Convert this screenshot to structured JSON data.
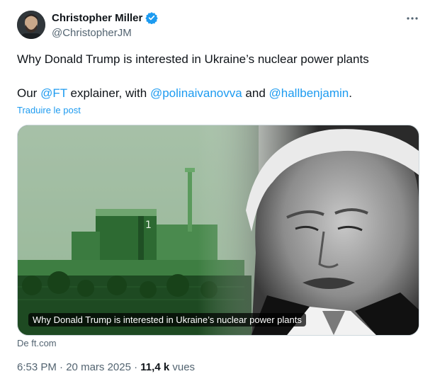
{
  "author": {
    "name": "Christopher Miller",
    "handle": "@ChristopherJM",
    "verified_icon": "verified-badge-icon"
  },
  "more_icon": "more-horizontal-icon",
  "tweet": {
    "line1": "Why Donald Trump is interested in Ukraine’s nuclear power plants",
    "line2_prefix": "Our ",
    "mention_ft": "@FT",
    "line2_mid": " explainer, with ",
    "mention_polina": "@polinaivanovva",
    "line2_and": " and ",
    "mention_hall": "@hallbenjamin",
    "line2_end": "."
  },
  "translate_label": "Traduire le post",
  "card": {
    "title": "Why Donald Trump is interested in Ukraine’s nuclear power plants",
    "source": "De ft.com"
  },
  "meta": {
    "time": "6:53 PM",
    "separator": " · ",
    "date": "20 mars 2025",
    "separator2": " · ",
    "views_count": "11,4 k",
    "views_label": " vues"
  },
  "colors": {
    "accent": "#1d9bf0",
    "secondary_text": "#536471",
    "primary_text": "#0f1419",
    "plant_tint": "#3f8f45"
  }
}
